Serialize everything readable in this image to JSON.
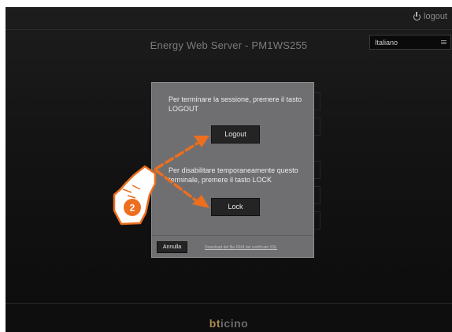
{
  "header": {
    "logout_label": "logout",
    "app_title": "Energy Web Server - PM1WS255",
    "language": "Italiano"
  },
  "modal": {
    "logout_text": "Per terminare la sessione, premere il tasto LOGOUT",
    "logout_button": "Logout",
    "lock_text": "Per disabilitare temporaneamente questo terminale, premere il tasto LOCK",
    "lock_button": "Lock",
    "cancel_button": "Annulla",
    "ssl_link": "Download del file PEM del certificato SSL"
  },
  "annotation": {
    "step_number": "2",
    "accent_color": "#ec6e1e"
  },
  "footer": {
    "brand_accent": "bt",
    "brand_rest": "icino"
  }
}
